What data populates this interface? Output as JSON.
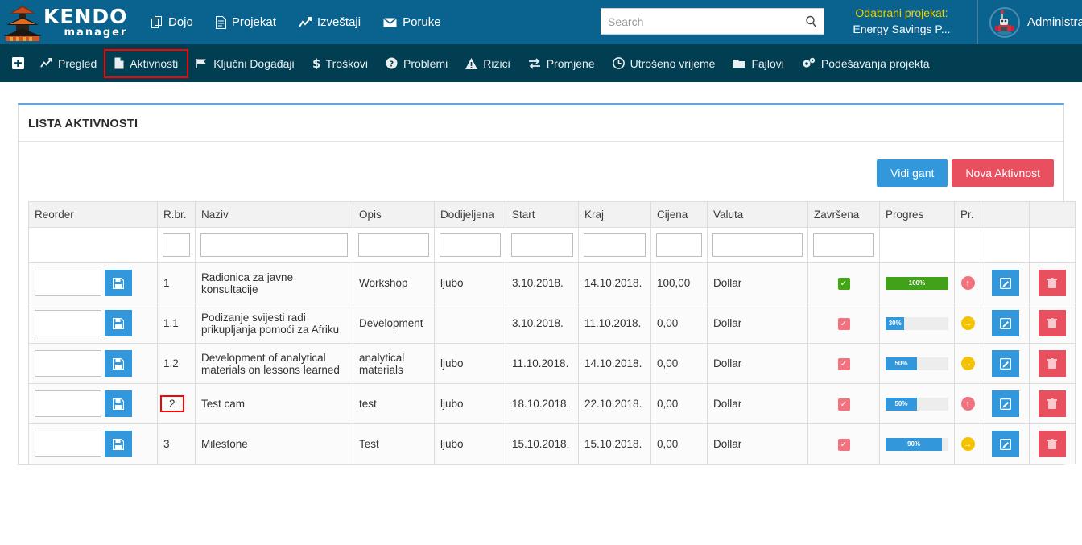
{
  "header": {
    "logo": {
      "line1": "KENDO",
      "line2": "manager",
      "icon": "pagoda-logo-icon"
    },
    "nav": [
      {
        "label": "Dojo",
        "icon": "copy-icon"
      },
      {
        "label": "Projekat",
        "icon": "document-icon"
      },
      {
        "label": "Izveštaji",
        "icon": "chart-line-icon"
      },
      {
        "label": "Poruke",
        "icon": "envelope-icon"
      }
    ],
    "search": {
      "placeholder": "Search",
      "value": "",
      "icon": "search-icon"
    },
    "project": {
      "label": "Odabrani projekat:",
      "value": "Energy Savings P..."
    },
    "user": {
      "name": "Administrat",
      "avatar_icon": "robot-avatar-icon"
    }
  },
  "subnav": {
    "plus_label": "➕",
    "items": [
      {
        "label": "Pregled",
        "icon": "chart-line-icon",
        "active": false
      },
      {
        "label": "Aktivnosti",
        "icon": "file-icon",
        "active": true
      },
      {
        "label": "Ključni Događaji",
        "icon": "flag-icon",
        "active": false
      },
      {
        "label": "Troškovi",
        "icon": "dollar-icon",
        "active": false
      },
      {
        "label": "Problemi",
        "icon": "question-circle-icon",
        "active": false
      },
      {
        "label": "Rizici",
        "icon": "warning-triangle-icon",
        "active": false
      },
      {
        "label": "Promjene",
        "icon": "exchange-arrows-icon",
        "active": false
      },
      {
        "label": "Utrošeno vrijeme",
        "icon": "clock-icon",
        "active": false
      },
      {
        "label": "Fajlovi",
        "icon": "folder-icon",
        "active": false
      },
      {
        "label": "Podešavanja projekta",
        "icon": "gears-icon",
        "active": false
      }
    ]
  },
  "panel": {
    "title": "LISTA AKTIVNOSTI",
    "buttons": {
      "gantt": "Vidi gant",
      "new_activity": "Nova Aktivnost"
    }
  },
  "table": {
    "columns": [
      "Reorder",
      "R.br.",
      "Naziv",
      "Opis",
      "Dodijeljena",
      "Start",
      "Kraj",
      "Cijena",
      "Valuta",
      "Završena",
      "Progres",
      "Pr.",
      "",
      ""
    ],
    "filters": {
      "rbr": "",
      "naziv": "",
      "opis": "",
      "dodijeljena": "",
      "start": "",
      "kraj": "",
      "cijena": "",
      "valuta": "",
      "zavrsena": ""
    },
    "icons": {
      "save": "save-disk-icon",
      "edit": "edit-pencil-icon",
      "delete": "trash-icon"
    },
    "rows": [
      {
        "reorder_value": "",
        "rbr": "1",
        "rbr_highlighted": false,
        "naziv": "Radionica za javne konsultacije",
        "opis": "Workshop",
        "dodijeljena": "ljubo",
        "start": "3.10.2018.",
        "kraj": "14.10.2018.",
        "cijena": "100,00",
        "valuta": "Dollar",
        "zavrsena": true,
        "zavrsena_color": "green",
        "progres": "100%",
        "progres_pct": 100,
        "progres_color": "green",
        "pr_icon": "arrow-up-circle-icon",
        "pr_color": "red"
      },
      {
        "reorder_value": "",
        "rbr": "1.1",
        "rbr_highlighted": false,
        "naziv": "Podizanje svijesti radi prikupljanja pomoći za Afriku",
        "opis": "Development",
        "dodijeljena": "",
        "start": "3.10.2018.",
        "kraj": "11.10.2018.",
        "cijena": "0,00",
        "valuta": "Dollar",
        "zavrsena": true,
        "zavrsena_color": "red",
        "progres": "30%",
        "progres_pct": 30,
        "progres_color": "blue",
        "pr_icon": "arrow-right-circle-icon",
        "pr_color": "yellow"
      },
      {
        "reorder_value": "",
        "rbr": "1.2",
        "rbr_highlighted": false,
        "naziv": "Development of analytical materials on lessons learned",
        "opis": "analytical materials",
        "dodijeljena": "ljubo",
        "start": "11.10.2018.",
        "kraj": "14.10.2018.",
        "cijena": "0,00",
        "valuta": "Dollar",
        "zavrsena": true,
        "zavrsena_color": "red",
        "progres": "50%",
        "progres_pct": 50,
        "progres_color": "blue",
        "pr_icon": "arrow-right-circle-icon",
        "pr_color": "yellow"
      },
      {
        "reorder_value": "",
        "rbr": "2",
        "rbr_highlighted": true,
        "naziv": "Test cam",
        "opis": "test",
        "dodijeljena": "ljubo",
        "start": "18.10.2018.",
        "kraj": "22.10.2018.",
        "cijena": "0,00",
        "valuta": "Dollar",
        "zavrsena": true,
        "zavrsena_color": "red",
        "progres": "50%",
        "progres_pct": 50,
        "progres_color": "blue",
        "pr_icon": "arrow-up-circle-icon",
        "pr_color": "red"
      },
      {
        "reorder_value": "",
        "rbr": "3",
        "rbr_highlighted": false,
        "naziv": "Milestone",
        "opis": "Test",
        "dodijeljena": "ljubo",
        "start": "15.10.2018.",
        "kraj": "15.10.2018.",
        "cijena": "0,00",
        "valuta": "Dollar",
        "zavrsena": true,
        "zavrsena_color": "red",
        "progres": "90%",
        "progres_pct": 90,
        "progres_color": "blue",
        "pr_icon": "arrow-right-circle-icon",
        "pr_color": "yellow"
      }
    ]
  },
  "colors": {
    "header_bg": "#0a628f",
    "subnav_bg": "#023e51",
    "accent_blue": "#3398db",
    "accent_red": "#e8505f",
    "highlight_outline": "#ff0000",
    "project_label": "#f5d000",
    "card_top_border": "#6aa3d5"
  }
}
